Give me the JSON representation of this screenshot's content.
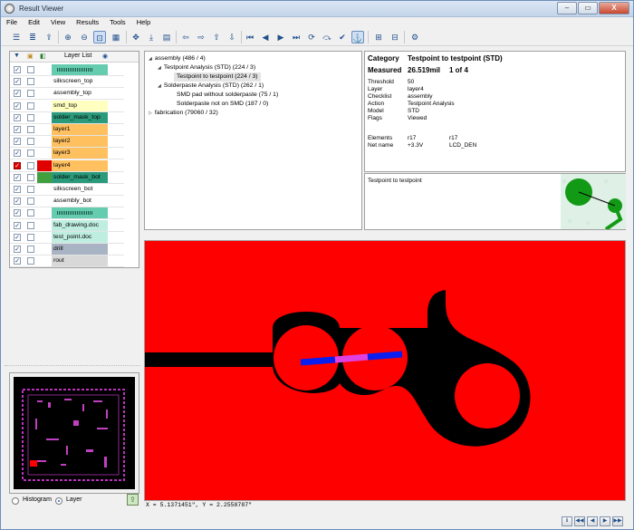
{
  "window": {
    "title": "Result Viewer",
    "controls": [
      "–",
      "▭",
      "X"
    ]
  },
  "menu": [
    "File",
    "Edit",
    "View",
    "Results",
    "Tools",
    "Help"
  ],
  "layer_panel": {
    "header": "Layer List",
    "layers": [
      {
        "name": "",
        "checked": true,
        "visible": false,
        "swatch": "",
        "bg": "#66ccb0",
        "pattern": true
      },
      {
        "name": "silkscreen_top",
        "checked": true,
        "visible": false,
        "swatch": "",
        "bg": "#ffffff"
      },
      {
        "name": "assembly_top",
        "checked": true,
        "visible": false,
        "swatch": "",
        "bg": "#ffffff"
      },
      {
        "name": "smd_top",
        "checked": true,
        "visible": false,
        "swatch": "",
        "bg": "#ffffc0"
      },
      {
        "name": "solder_mask_top",
        "checked": true,
        "visible": false,
        "swatch": "",
        "bg": "#2a9a7a"
      },
      {
        "name": "layer1",
        "checked": true,
        "visible": false,
        "swatch": "",
        "bg": "#ffc060"
      },
      {
        "name": "layer2",
        "checked": true,
        "visible": false,
        "swatch": "",
        "bg": "#ffc060"
      },
      {
        "name": "layer3",
        "checked": true,
        "visible": false,
        "swatch": "",
        "bg": "#ffc060"
      },
      {
        "name": "layer4",
        "checked": true,
        "visible": false,
        "swatch": "#e00000",
        "bg": "#ffc060",
        "highlight": true
      },
      {
        "name": "solder_mask_bot",
        "checked": true,
        "visible": false,
        "swatch": "#40a040",
        "bg": "#2a9a7a"
      },
      {
        "name": "silkscreen_bot",
        "checked": true,
        "visible": false,
        "swatch": "",
        "bg": "#ffffff"
      },
      {
        "name": "assembly_bot",
        "checked": true,
        "visible": false,
        "swatch": "",
        "bg": "#ffffff"
      },
      {
        "name": "",
        "checked": true,
        "visible": false,
        "swatch": "",
        "bg": "#66ccb0",
        "pattern": true
      },
      {
        "name": "fab_drawing.doc",
        "checked": true,
        "visible": false,
        "swatch": "",
        "bg": "#bfeee0"
      },
      {
        "name": "test_point.doc",
        "checked": true,
        "visible": false,
        "swatch": "",
        "bg": "#bfeee0"
      },
      {
        "name": "drill",
        "checked": true,
        "visible": false,
        "swatch": "",
        "bg": "#a8b4c4"
      },
      {
        "name": "rout",
        "checked": true,
        "visible": false,
        "swatch": "",
        "bg": "#d8d8d8"
      }
    ]
  },
  "view_mode": {
    "histogram": "Histogram",
    "layer": "Layer",
    "selected": "layer"
  },
  "tree": [
    {
      "label": "assembly (486 / 4)",
      "expanded": true
    },
    {
      "label": "Testpoint Analysis (STD) (224 / 3)",
      "expanded": true
    },
    {
      "label": "Testpoint to testpoint (224 / 3)",
      "selected": true
    },
    {
      "label": "Solderpaste Analysis (STD) (262 / 1)",
      "expanded": true
    },
    {
      "label": "SMD pad without solderpaste (75 / 1)"
    },
    {
      "label": "Solderpaste not on SMD (187 / 0)"
    },
    {
      "label": "fabrication (79060 / 32)",
      "expanded": false
    }
  ],
  "details": {
    "category_label": "Category",
    "category_value": "Testpoint to testpoint  (STD)",
    "measured_label": "Measured",
    "measured_value": "26.519mil",
    "measured_index": "1 of 4",
    "fields": [
      {
        "label": "Threshold",
        "value": "50"
      },
      {
        "label": "Layer",
        "value": "layer4"
      },
      {
        "label": "Checklist",
        "value": "assembly"
      },
      {
        "label": "Action",
        "value": "Testpoint Analysis"
      },
      {
        "label": "Model",
        "value": "STD"
      },
      {
        "label": "Flags",
        "value": "Viewed"
      }
    ],
    "elements_label": "Elements",
    "elements": [
      "r17",
      "r17"
    ],
    "netname_label": "Net name",
    "netnames": [
      "+3.3V",
      "LCD_DEN"
    ]
  },
  "preview": {
    "text": "Testpoint to testpoint"
  },
  "status": {
    "coordinates": "X = 5.1371451\", Y = 2.2558787\""
  },
  "colors": {
    "copper": "#ff0000",
    "background": "#000000",
    "marker_blue": "#0a1ef0",
    "marker_magenta": "#e040e0"
  }
}
